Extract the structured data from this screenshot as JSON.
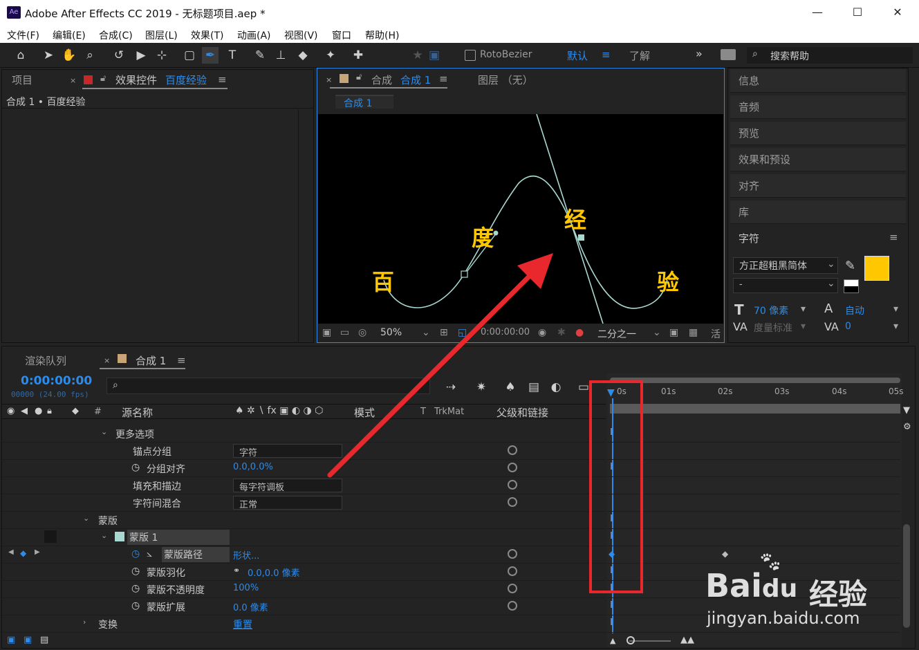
{
  "window": {
    "logo": "Ae",
    "title": "Adobe After Effects CC 2019 - 无标题项目.aep *",
    "min": "—",
    "max": "☐",
    "close": "✕"
  },
  "menu": [
    "文件(F)",
    "编辑(E)",
    "合成(C)",
    "图层(L)",
    "效果(T)",
    "动画(A)",
    "视图(V)",
    "窗口",
    "帮助(H)"
  ],
  "toolbar": {
    "rotobezier": "RotoBezier",
    "workspace_default": "默认",
    "workspace_learn": "了解",
    "search_placeholder": "搜索帮助",
    "more": "»"
  },
  "project_panel": {
    "tab_project": "项目",
    "tab_effects": "效果控件",
    "tab_effects_target": "百度经验",
    "breadcrumb": "合成 1 • 百度经验"
  },
  "comp_panel": {
    "tab_prefix": "合成",
    "tab_name": "合成 1",
    "layer_tab": "图层 （无）",
    "comp_label": "合成 1",
    "zoom": "50%",
    "timecode": "0:00:00:00",
    "resolution": "二分之一",
    "more": "活"
  },
  "viewer_text": [
    "百",
    "度",
    "经",
    "验"
  ],
  "right_panel": {
    "items": [
      "信息",
      "音频",
      "预览",
      "效果和预设",
      "对齐",
      "库"
    ],
    "char_title": "字符",
    "font": "方正超粗黑简体",
    "style": "-",
    "size": "70 像素",
    "tracking_mode": "自动",
    "kerning": "度量标准",
    "tracking_val": "0",
    "fill_color": "#ffc700"
  },
  "timeline": {
    "tab_render": "渲染队列",
    "tab_comp": "合成 1",
    "timecode": "0:00:00:00",
    "frames": "00000 (24.00 fps)",
    "search_placeholder": "",
    "col_num": "#",
    "col_source": "源名称",
    "col_mode": "模式",
    "col_t": "T",
    "col_trkmat": "TrkMat",
    "col_parent": "父级和链接",
    "ruler": [
      "0s",
      "01s",
      "02s",
      "03s",
      "04s",
      "05s"
    ],
    "rows": [
      {
        "label": "更多选项",
        "value": ""
      },
      {
        "label": "锚点分组",
        "value": "字符"
      },
      {
        "label": "分组对齐",
        "value": "0.0,0.0%"
      },
      {
        "label": "填充和描边",
        "value": "每字符调板"
      },
      {
        "label": "字符间混合",
        "value": "正常"
      },
      {
        "label": "蒙版",
        "value": ""
      },
      {
        "label": "蒙版 1",
        "value": ""
      },
      {
        "label": "蒙版路径",
        "value": "形状..."
      },
      {
        "label": "蒙版羽化",
        "value": "0.0,0.0 像素"
      },
      {
        "label": "蒙版不透明度",
        "value": "100%"
      },
      {
        "label": "蒙版扩展",
        "value": "0.0 像素"
      },
      {
        "label": "变换",
        "value": "重置"
      }
    ]
  },
  "watermark": {
    "brand": "Bai",
    "brand2": "du",
    "label": "经验",
    "url": "jingyan.baidu.com"
  },
  "colors": {
    "accent": "#2d8ceb",
    "highlight": "#e8282c",
    "text_yellow": "#ffc700"
  }
}
